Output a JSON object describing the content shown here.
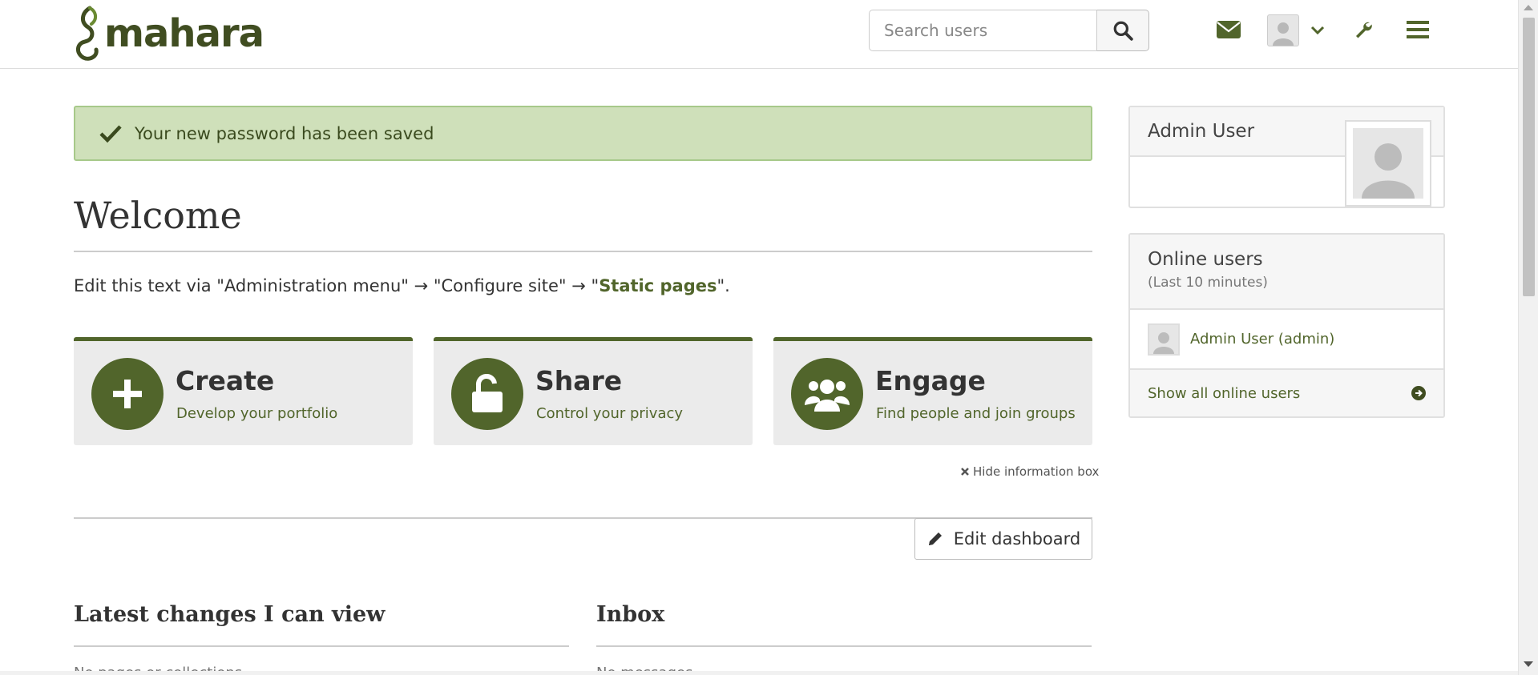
{
  "header": {
    "logo_text": "mahara",
    "search_placeholder": "Search users",
    "icons": [
      "envelope-icon",
      "user-avatar-icon",
      "chevron-down-icon",
      "wrench-icon",
      "hamburger-menu-icon"
    ]
  },
  "alert": {
    "text": "Your new password has been saved",
    "icon": "check-icon"
  },
  "main": {
    "title": "Welcome",
    "intro_prefix": "Edit this text via \"Administration menu\" → \"Configure site\" → \"",
    "intro_link": "Static pages",
    "intro_suffix": "\".",
    "boxes": [
      {
        "title": "Create",
        "subtitle": "Develop your portfolio",
        "icon": "plus-icon"
      },
      {
        "title": "Share",
        "subtitle": "Control your privacy",
        "icon": "unlock-icon"
      },
      {
        "title": "Engage",
        "subtitle": "Find people and join groups",
        "icon": "users-icon"
      }
    ],
    "hide_info_label": "Hide information box",
    "edit_dashboard_label": "Edit dashboard",
    "sections": [
      {
        "title": "Latest changes I can view",
        "cutoff_text": "No pages or collections"
      },
      {
        "title": "Inbox",
        "cutoff_text": "No messages"
      }
    ]
  },
  "sidebar": {
    "profile": {
      "name": "Admin User"
    },
    "online": {
      "title": "Online users",
      "subtitle": "(Last 10 minutes)",
      "users": [
        {
          "name": "Admin User (admin)"
        }
      ],
      "show_all_label": "Show all online users"
    }
  },
  "colors": {
    "brand": "#51652b",
    "logo": "#404d21",
    "alert_bg": "#cfe0ba",
    "alert_border": "#a7c98a",
    "box_bg": "#ebebeb"
  }
}
